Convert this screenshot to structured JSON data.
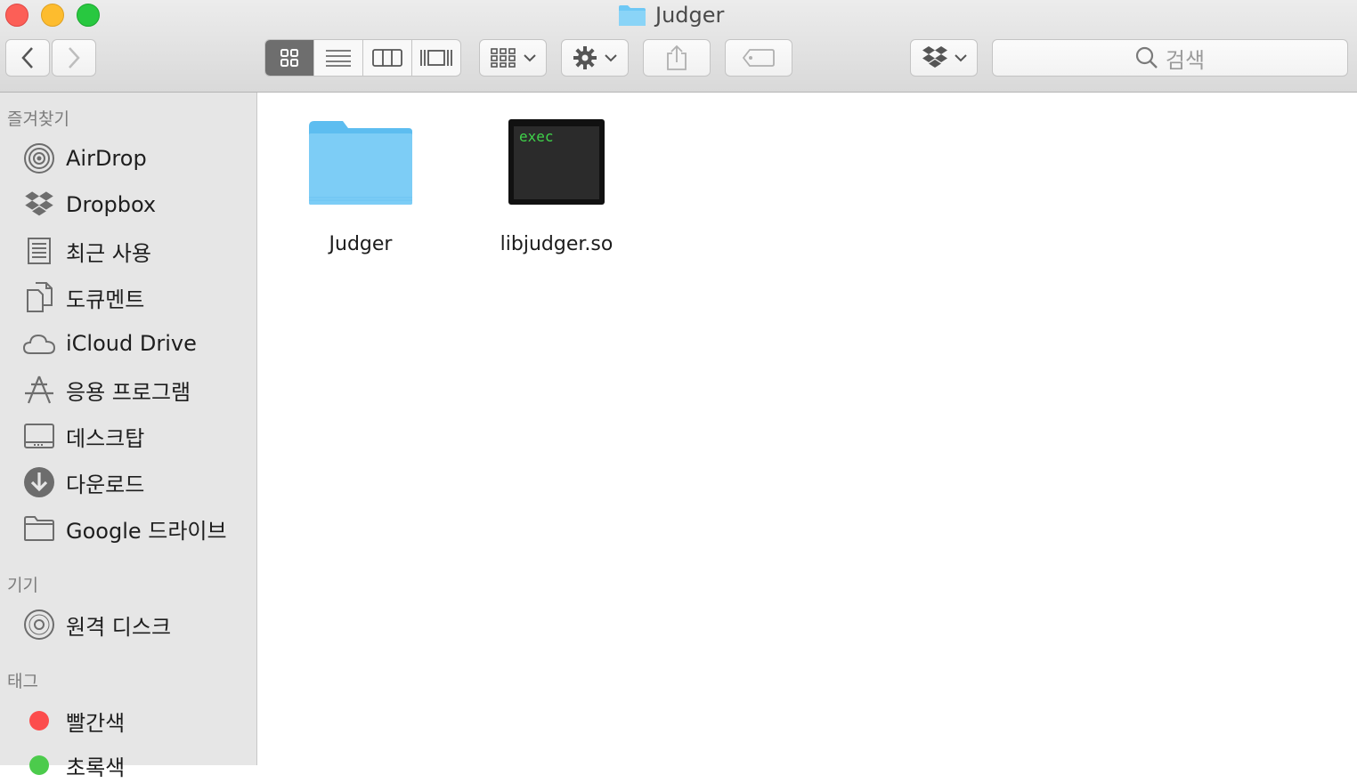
{
  "window": {
    "title": "Judger"
  },
  "search": {
    "placeholder": "검색"
  },
  "sidebar": {
    "favorites_title": "즐겨찾기",
    "favorites": [
      {
        "label": "AirDrop",
        "icon": "airdrop-icon"
      },
      {
        "label": "Dropbox",
        "icon": "dropbox-icon"
      },
      {
        "label": "최근 사용",
        "icon": "recents-icon"
      },
      {
        "label": "도큐멘트",
        "icon": "documents-icon"
      },
      {
        "label": "iCloud Drive",
        "icon": "icloud-icon"
      },
      {
        "label": "응용 프로그램",
        "icon": "applications-icon"
      },
      {
        "label": "데스크탑",
        "icon": "desktop-icon"
      },
      {
        "label": "다운로드",
        "icon": "downloads-icon"
      },
      {
        "label": "Google 드라이브",
        "icon": "folder-icon"
      }
    ],
    "devices_title": "기기",
    "devices": [
      {
        "label": "원격 디스크",
        "icon": "remote-disc-icon"
      }
    ],
    "tags_title": "태그",
    "tags": [
      {
        "label": "빨간색",
        "color": "#fc4c4c"
      },
      {
        "label": "초록색",
        "color": "#4ccb4c"
      }
    ]
  },
  "files": [
    {
      "name": "Judger",
      "icon": "folder-icon"
    },
    {
      "name": "libjudger.so",
      "icon": "exec-icon",
      "badge": "exec"
    }
  ],
  "colors": {
    "folder": "#6ec8f5",
    "accent_active_segment": "#6e6e6e"
  }
}
